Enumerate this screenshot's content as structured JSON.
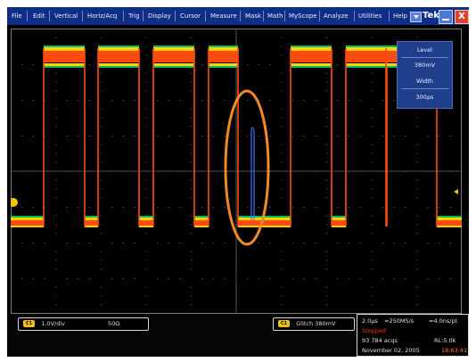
{
  "menubar": {
    "items": [
      "File",
      "Edit",
      "Vertical",
      "Horiz/Acq",
      "Trig",
      "Display",
      "Cursor",
      "Measure",
      "Mask",
      "Math",
      "MyScope",
      "Analyze",
      "Utilities",
      "Help"
    ],
    "brand": "Tek",
    "close_glyph": "X"
  },
  "overlay": {
    "level_label": "Level",
    "level_value": "380mV",
    "width_label": "Width",
    "width_value": "300ps"
  },
  "readouts": {
    "ch1_badge": "C1",
    "ch1_scale": "1.0V/div",
    "ch1_impedance": "50Ω",
    "trigger_badge": "C1",
    "trigger_type": "Glitch",
    "trigger_level": "380mV",
    "timebase": "2.0µs",
    "sample_rate": "≈250MS/s",
    "record_length": "≈4.0ns/pt",
    "run_state": "Stopped",
    "acqs": "93 784 acqs",
    "rl": "RL:5.0k",
    "date": "November 02, 2005",
    "time": "18:63:41"
  },
  "colors": {
    "menubar_bg": "#0f2f86",
    "screen_bg": "#000000",
    "trace_hot": "#ff4a10",
    "trace_warm": "#ffd400",
    "trace_cool": "#00c060",
    "glitch_trace": "#3d6dff",
    "highlight_ellipse": "#f08a24",
    "marker": "#f2c200",
    "stopped": "#ff3a00"
  }
}
